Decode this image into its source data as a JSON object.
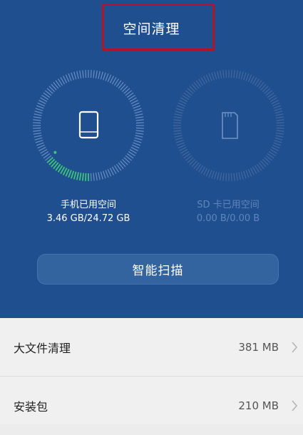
{
  "header": {
    "title": "空间清理"
  },
  "phone_storage": {
    "label": "手机已用空间",
    "value": "3.46 GB/24.72 GB",
    "used_fraction": 0.14,
    "accent_color": "#3ec47a"
  },
  "sd_storage": {
    "label": "SD 卡已用空间",
    "value": "0.00 B/0.00 B",
    "used_fraction": 0
  },
  "scan_button": {
    "label": "智能扫描"
  },
  "list": {
    "items": [
      {
        "name": "大文件清理",
        "size": "381 MB"
      },
      {
        "name": "安装包",
        "size": "210 MB"
      }
    ]
  },
  "colors": {
    "header_bg": "#1f4f8f",
    "highlight_border": "#b0152a"
  }
}
